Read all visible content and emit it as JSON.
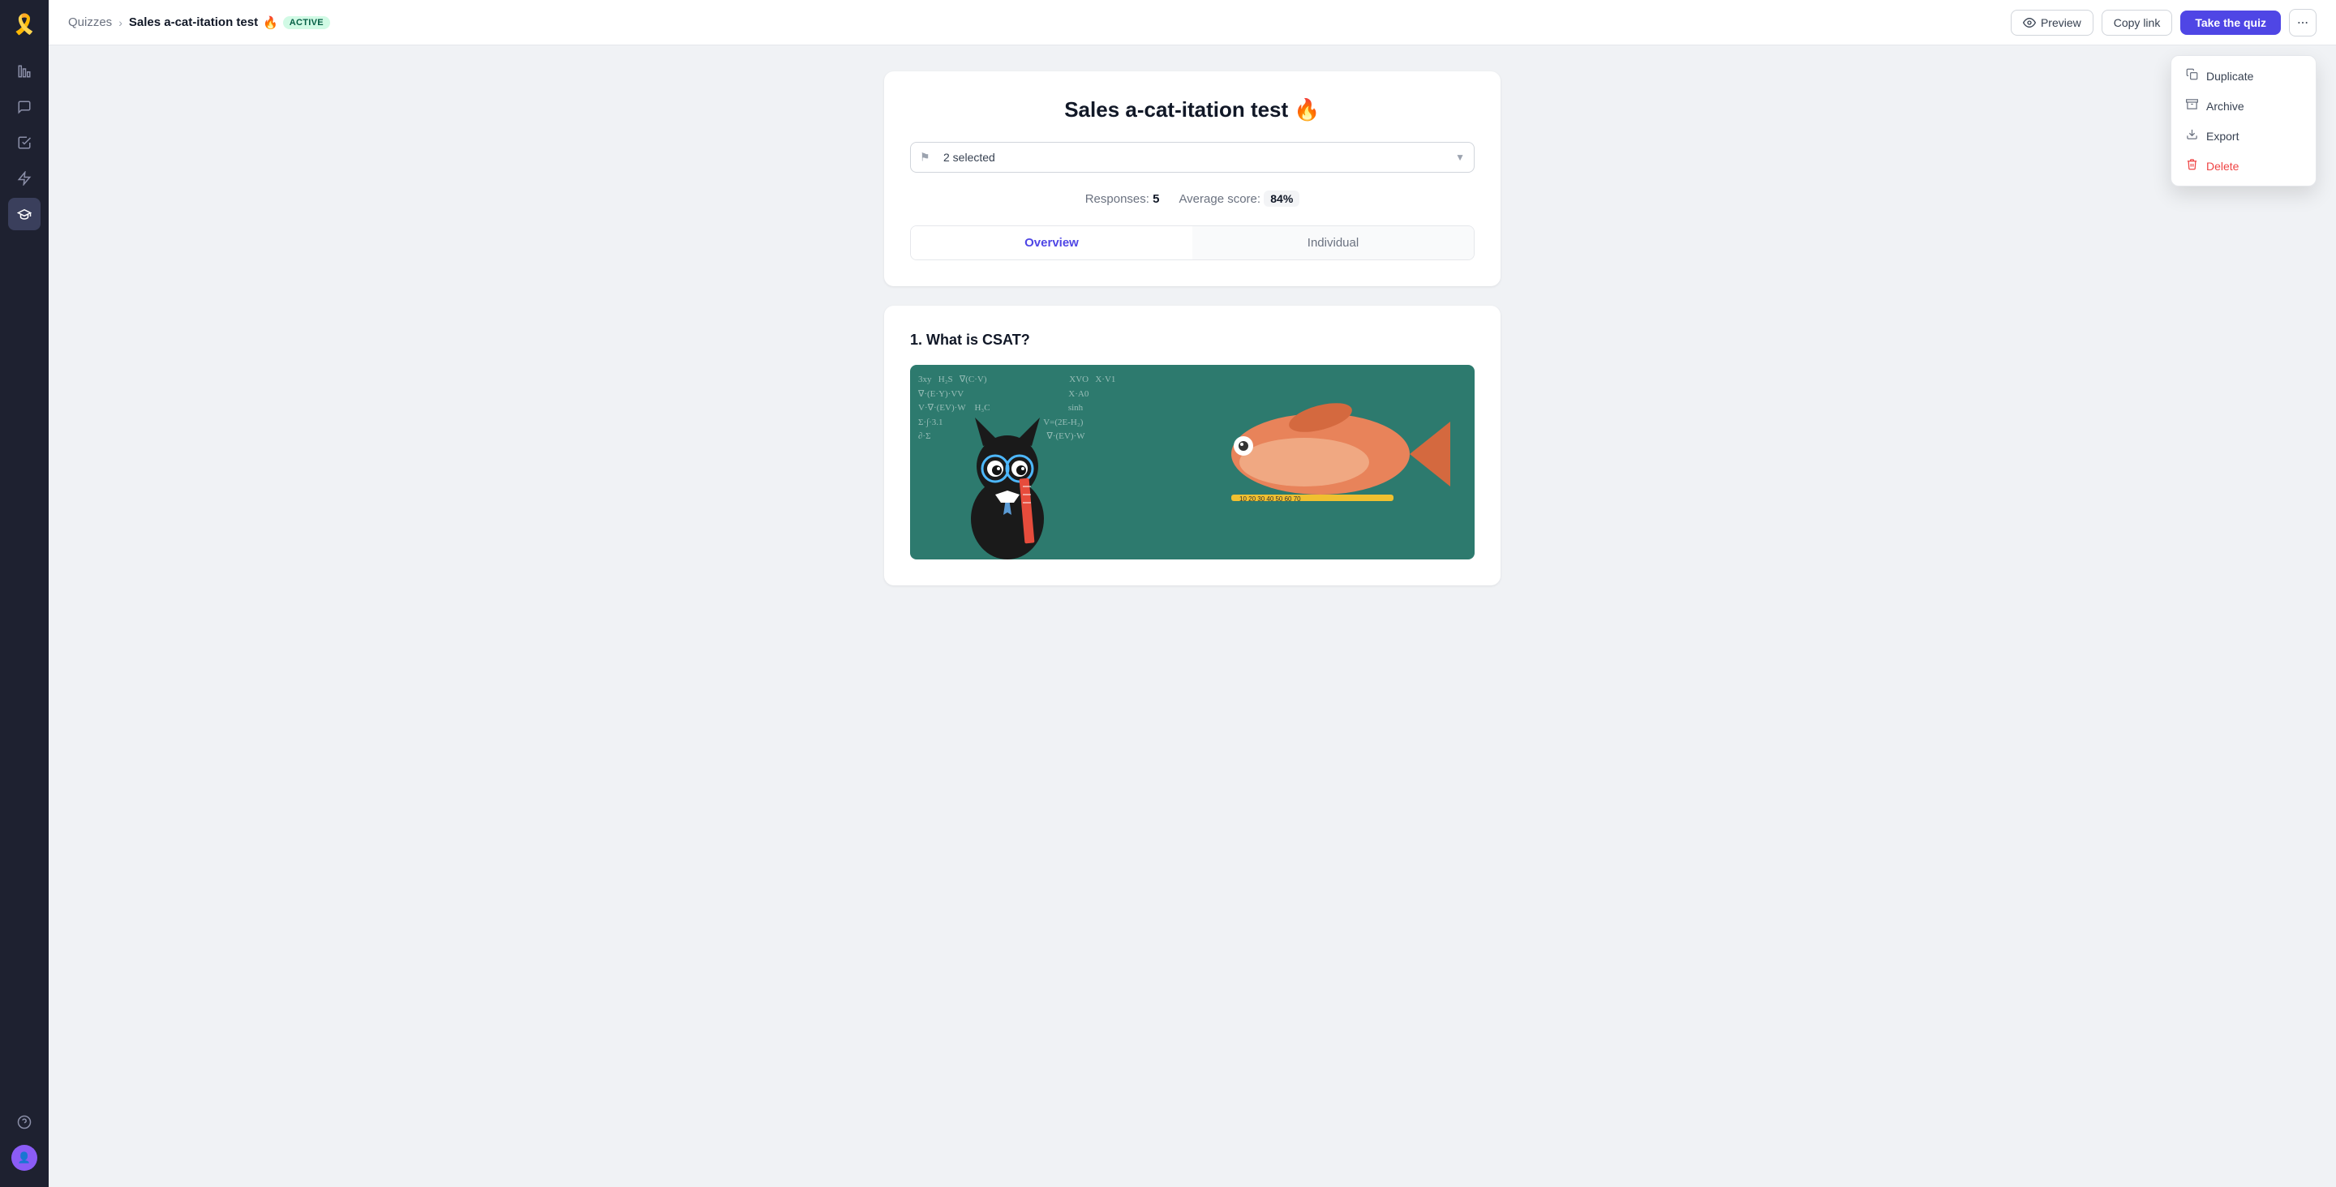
{
  "sidebar": {
    "logo": "🎗️",
    "items": [
      {
        "id": "analytics",
        "icon": "📊",
        "label": "Analytics"
      },
      {
        "id": "messages",
        "icon": "💬",
        "label": "Messages"
      },
      {
        "id": "tasks",
        "icon": "✅",
        "label": "Tasks"
      },
      {
        "id": "lightning",
        "icon": "⚡",
        "label": "Automation"
      },
      {
        "id": "learn",
        "icon": "🎓",
        "label": "Learn",
        "active": true
      }
    ],
    "bottom": [
      {
        "id": "help",
        "icon": "❓",
        "label": "Help"
      }
    ]
  },
  "header": {
    "breadcrumb_parent": "Quizzes",
    "breadcrumb_separator": "›",
    "current_title": "Sales a-cat-itation test",
    "fire_emoji": "🔥",
    "active_badge": "Active",
    "preview_label": "Preview",
    "copy_link_label": "Copy link",
    "take_quiz_label": "Take the quiz",
    "more_icon": "···"
  },
  "dropdown": {
    "items": [
      {
        "id": "duplicate",
        "icon": "⧉",
        "label": "Duplicate"
      },
      {
        "id": "archive",
        "icon": "🗄",
        "label": "Archive"
      },
      {
        "id": "export",
        "icon": "⬇",
        "label": "Export"
      },
      {
        "id": "delete",
        "icon": "🗑",
        "label": "Delete",
        "danger": true
      }
    ]
  },
  "quiz_card": {
    "title": "Sales a-cat-itation test",
    "fire_emoji": "🔥",
    "select_placeholder": "2 selected",
    "flag_icon": "⚑",
    "responses_label": "Responses:",
    "responses_count": "5",
    "avg_score_label": "Average score:",
    "avg_score_value": "84%",
    "tabs": [
      {
        "id": "overview",
        "label": "Overview",
        "active": true
      },
      {
        "id": "individual",
        "label": "Individual",
        "active": false
      }
    ]
  },
  "question": {
    "number": "1.",
    "title": "What is CSAT?",
    "has_image": true,
    "equations": "3xy   H₂S   ∇(C-V)   XVO   X·V1   X·A0   V·∇(E·Y)·VV   sinh   V=(2E-H₂)   ∇·(EV)·W   H₃C   Σ·∫·3.1   ∂·∑   Σ·∇·VY"
  },
  "colors": {
    "primary": "#4f46e5",
    "active_badge_bg": "#d1fae5",
    "active_badge_text": "#065f46",
    "sidebar_bg": "#1e2130",
    "chalkboard_bg": "#2d7a6e"
  }
}
